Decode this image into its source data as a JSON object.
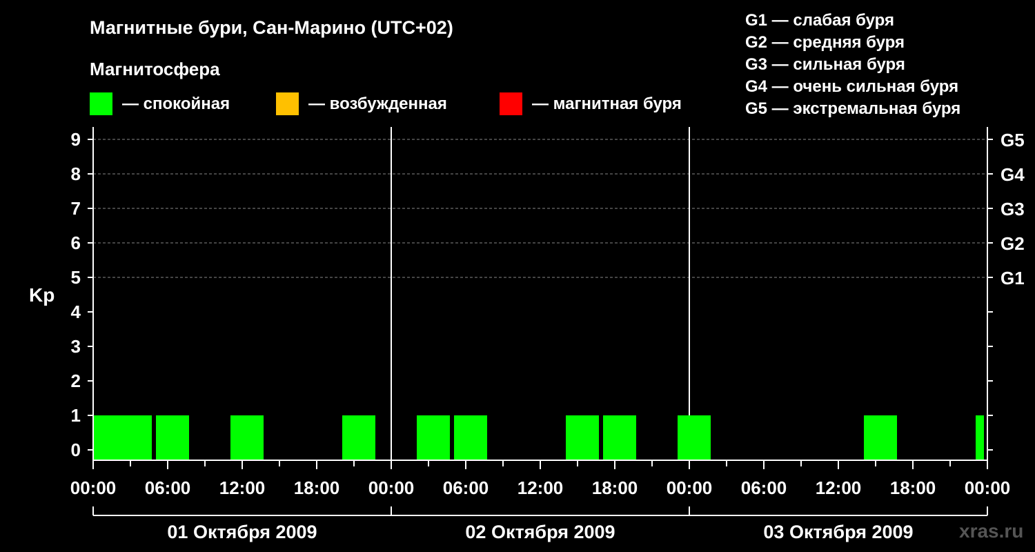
{
  "title": "Магнитные бури, Сан-Марино (UTC+02)",
  "legend": {
    "heading": "Магнитосфера",
    "items": [
      {
        "label": "— спокойная",
        "color": "#00ff00"
      },
      {
        "label": "— возбужденная",
        "color": "#ffc000"
      },
      {
        "label": "— магнитная буря",
        "color": "#ff0000"
      }
    ]
  },
  "g_scale": [
    "G1 — слабая буря",
    "G2 — средняя буря",
    "G3 — сильная буря",
    "G4 — очень сильная буря",
    "G5 — экстремальная буря"
  ],
  "watermark": "xras.ru",
  "chart_data": {
    "type": "bar",
    "ylabel": "Kp",
    "ylim": [
      0,
      9
    ],
    "y_ticks": [
      "0",
      "1",
      "2",
      "3",
      "4",
      "5",
      "6",
      "7",
      "8",
      "9"
    ],
    "right_ticks": [
      {
        "kp": 5,
        "label": "G1"
      },
      {
        "kp": 6,
        "label": "G2"
      },
      {
        "kp": 7,
        "label": "G3"
      },
      {
        "kp": 8,
        "label": "G4"
      },
      {
        "kp": 9,
        "label": "G5"
      }
    ],
    "x_hours_range": [
      0,
      72
    ],
    "x_tick_labels": [
      "00:00",
      "06:00",
      "12:00",
      "18:00",
      "00:00",
      "06:00",
      "12:00",
      "18:00",
      "00:00",
      "06:00",
      "12:00",
      "18:00",
      "00:00"
    ],
    "days": [
      "01 Октября 2009",
      "02 Октября 2009",
      "03 Октября 2009"
    ],
    "grid": "dashed at Kp 5-9",
    "bars": [
      {
        "start_hour": 0,
        "value": 1,
        "color": "#00ff00"
      },
      {
        "start_hour": 2,
        "value": 1,
        "color": "#00ff00"
      },
      {
        "start_hour": 5,
        "value": 1,
        "color": "#00ff00"
      },
      {
        "start_hour": 11,
        "value": 1,
        "color": "#00ff00"
      },
      {
        "start_hour": 20,
        "value": 1,
        "color": "#00ff00"
      },
      {
        "start_hour": 26,
        "value": 1,
        "color": "#00ff00"
      },
      {
        "start_hour": 29,
        "value": 1,
        "color": "#00ff00"
      },
      {
        "start_hour": 38,
        "value": 1,
        "color": "#00ff00"
      },
      {
        "start_hour": 41,
        "value": 1,
        "color": "#00ff00"
      },
      {
        "start_hour": 47,
        "value": 1,
        "color": "#00ff00"
      },
      {
        "start_hour": 62,
        "value": 1,
        "color": "#00ff00"
      },
      {
        "start_hour": 71,
        "value": 1,
        "color": "#00ff00"
      }
    ]
  }
}
